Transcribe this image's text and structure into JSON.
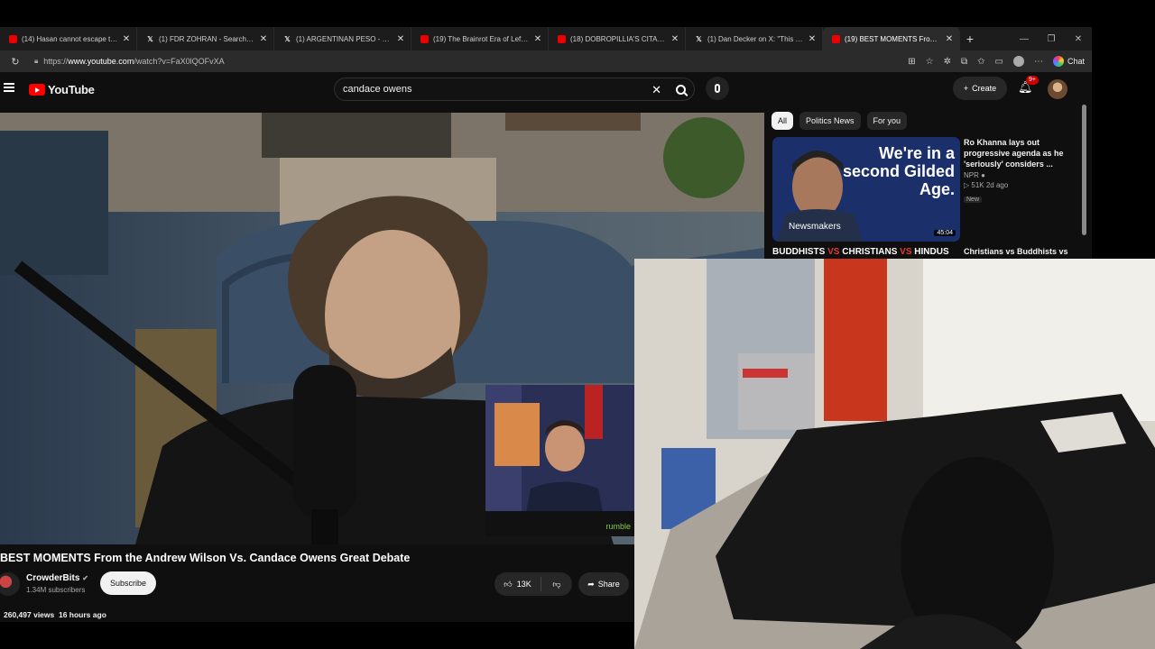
{
  "browser": {
    "tabs": [
      {
        "title": "(14) Hasan cannot escape the DOJ",
        "favicon": "youtube-icon"
      },
      {
        "title": "(1) FDR ZOHRAN - Search / X",
        "favicon": "x-icon"
      },
      {
        "title": "(1) ARGENTINAN PESO - Search / X",
        "favicon": "x-icon"
      },
      {
        "title": "(19) The Brainrot Era of Leftist Me",
        "favicon": "youtube-icon"
      },
      {
        "title": "(18) DOBROPILLIA'S CITADEL UNDER",
        "favicon": "youtube-icon"
      },
      {
        "title": "(1) Dan Decker on X: \"This is the",
        "favicon": "x-icon"
      },
      {
        "title": "(19) BEST MOMENTS From the Andrew",
        "favicon": "youtube-icon",
        "active": true
      }
    ],
    "url_prefix": "https://",
    "url_host": "www.youtube.com",
    "url_path": "/watch?v=FaX0lQOFvXA",
    "chat_label": "Chat"
  },
  "header": {
    "logo_text": "YouTube",
    "search_value": "candace owens",
    "create_label": "Create",
    "notification_count": "9+"
  },
  "sidebar": {
    "chips": [
      "All",
      "Politics News",
      "For you"
    ],
    "rec1": {
      "thumb_quote": "We're in a second Gilded Age.",
      "thumb_label": "Newsmakers",
      "duration": "45:04",
      "title": "Ro Khanna lays out progressive agenda as he 'seriously' considers ...",
      "channel": "NPR",
      "stats": "▷ 51K  2d ago",
      "badge": "New"
    },
    "rec2": {
      "thumb_words": [
        "BUDDHISTS",
        "VS",
        "CHRISTIANS",
        "VS",
        "HINDUS"
      ],
      "title": "Christians vs Buddhists vs"
    }
  },
  "video": {
    "title": "BEST MOMENTS From the Andrew Wilson Vs. Candace Owens Great Debate",
    "channel": "CrowderBits",
    "subscribers": "1.34M subscribers",
    "subscribe_label": "Subscribe",
    "likes": "13K",
    "share_label": "Share",
    "views": "260,497 views",
    "age": "16 hours ago",
    "inset_logo": "rumble"
  },
  "colors": {
    "yt_bg": "#0f0f0f",
    "yt_red": "#ff0000",
    "chip_bg": "#272727",
    "rumble_green": "#85c742"
  }
}
